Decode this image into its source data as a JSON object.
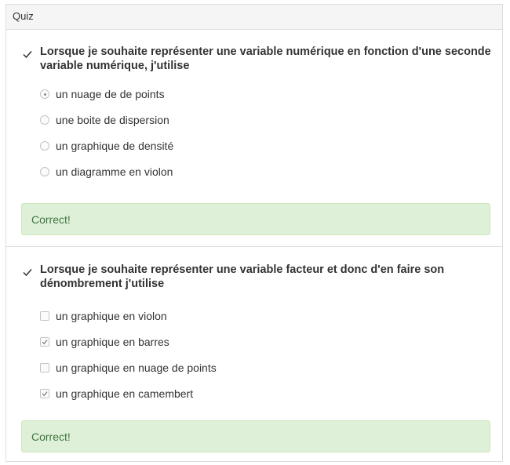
{
  "panel": {
    "title": "Quiz"
  },
  "questions": [
    {
      "text": "Lorsque je souhaite représenter une variable numérique en fonction d'une seconde variable numérique, j'utilise",
      "input_type": "radio",
      "options": [
        {
          "label": "un nuage de de points",
          "checked": true
        },
        {
          "label": "une boite de dispersion",
          "checked": false
        },
        {
          "label": "un graphique de densité",
          "checked": false
        },
        {
          "label": "un diagramme en violon",
          "checked": false
        }
      ],
      "feedback": "Correct!"
    },
    {
      "text": "Lorsque je souhaite représenter une variable facteur et donc d'en faire son dénombrement j'utilise",
      "input_type": "checkbox",
      "options": [
        {
          "label": "un graphique en violon",
          "checked": false
        },
        {
          "label": "un graphique en barres",
          "checked": true
        },
        {
          "label": "un graphique en nuage de points",
          "checked": false
        },
        {
          "label": "un graphique en camembert",
          "checked": true
        }
      ],
      "feedback": "Correct!"
    }
  ],
  "colors": {
    "success_bg": "#dff0d8",
    "success_text": "#3c763d",
    "border": "#dddddd",
    "heading_bg": "#f5f5f5"
  },
  "icons": {
    "answered": "checkmark-icon"
  }
}
